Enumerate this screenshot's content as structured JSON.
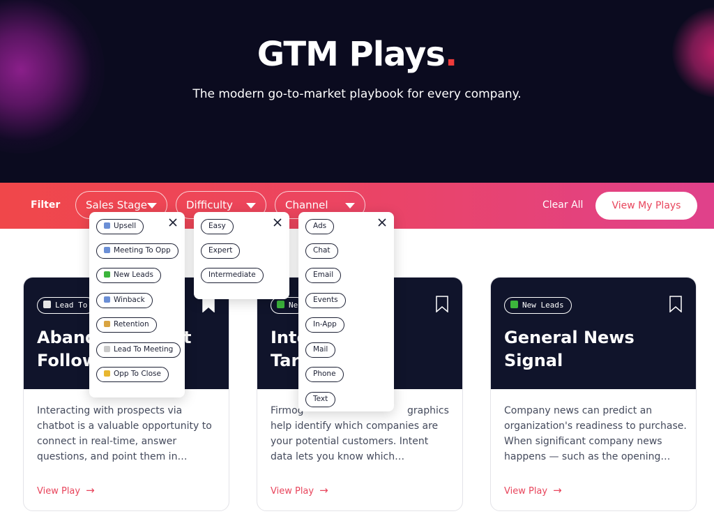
{
  "hero": {
    "title": "GTM Plays",
    "title_dot": ".",
    "subtitle": "The modern go-to-market playbook for every company."
  },
  "filter": {
    "label": "Filter",
    "sales_stage": "Sales Stage",
    "difficulty": "Difficulty",
    "channel": "Channel",
    "clear_all": "Clear All",
    "view_my_plays": "View My Plays"
  },
  "dropdowns": {
    "sales_stage": [
      {
        "label": "Upsell",
        "icon": "up-arrow-icon",
        "color": "#6b8fd6"
      },
      {
        "label": "Meeting To Opp",
        "icon": "fast-forward-icon",
        "color": "#6b8fd6"
      },
      {
        "label": "New Leads",
        "icon": "check-icon",
        "color": "#3cb53c"
      },
      {
        "label": "Winback",
        "icon": "refresh-icon",
        "color": "#6b8fd6"
      },
      {
        "label": "Retention",
        "icon": "lock-icon",
        "color": "#d9a441"
      },
      {
        "label": "Lead To Meeting",
        "icon": "calendar-icon",
        "color": "#c9c9c9"
      },
      {
        "label": "Opp To Close",
        "icon": "handshake-icon",
        "color": "#e8b730"
      }
    ],
    "difficulty": [
      {
        "label": "Easy"
      },
      {
        "label": "Expert"
      },
      {
        "label": "Intermediate"
      }
    ],
    "channel": [
      {
        "label": "Ads"
      },
      {
        "label": "Chat"
      },
      {
        "label": "Email"
      },
      {
        "label": "Events"
      },
      {
        "label": "In-App"
      },
      {
        "label": "Mail"
      },
      {
        "label": "Phone"
      },
      {
        "label": "Text"
      }
    ]
  },
  "cards": [
    {
      "tag": "Lead To",
      "tag_icon": "calendar-icon",
      "tag_color": "#e6e6e6",
      "title": "Abandoned Chat Follow",
      "desc": "Interacting with prospects via chatbot is a valuable opportunity to connect in real-time, answer questions, and point them in…",
      "link": "View Play"
    },
    {
      "tag": "Ne",
      "tag_icon": "check-icon",
      "tag_color": "#3cb53c",
      "title": "Intent Data Targeting",
      "desc": "Firmographics help identify which companies are your potential customers. Intent data lets you know which…",
      "link": "View Play"
    },
    {
      "tag": "New Leads",
      "tag_icon": "check-icon",
      "tag_color": "#3cb53c",
      "title": "General News Signal",
      "desc": "Company news can predict an organization's readiness to purchase. When significant company news happens — such as the opening…",
      "link": "View Play"
    }
  ],
  "card_text_visible": {
    "card1_title_line1": "Aband",
    "card1_title_line2": "Follow",
    "card1_title_tail": "t",
    "card2_title_line1": "Inte",
    "card2_title_line2": "Tar",
    "card2_desc_line1a": "Firmog",
    "card2_desc_line1b": "graphics",
    "card2_desc_rest": "help identify which companies are your potential customers. Intent data lets you know which…"
  }
}
